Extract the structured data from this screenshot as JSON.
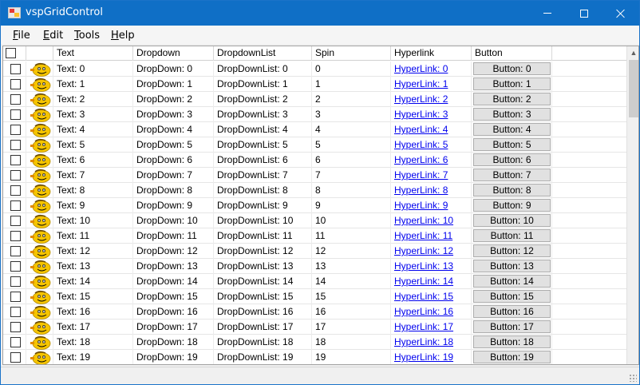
{
  "window": {
    "title": "vspGridControl"
  },
  "menu": [
    {
      "label": "File",
      "mnemonic": "F",
      "rest": "ile"
    },
    {
      "label": "Edit",
      "mnemonic": "E",
      "rest": "dit"
    },
    {
      "label": "Tools",
      "mnemonic": "T",
      "rest": "ools"
    },
    {
      "label": "Help",
      "mnemonic": "H",
      "rest": "elp"
    }
  ],
  "grid": {
    "columns": [
      "Text",
      "Dropdown",
      "DropdownList",
      "Spin",
      "Hyperlink",
      "Button"
    ],
    "row_icon": "smiley-face-icon",
    "rows": [
      {
        "checked": false,
        "text": "Text: 0",
        "dropdown": "DropDown: 0",
        "dropdownlist": "DropDownList: 0",
        "spin": "0",
        "hyperlink": "HyperLink: 0",
        "button": "Button: 0"
      },
      {
        "checked": false,
        "text": "Text: 1",
        "dropdown": "DropDown: 1",
        "dropdownlist": "DropDownList: 1",
        "spin": "1",
        "hyperlink": "HyperLink: 1",
        "button": "Button: 1"
      },
      {
        "checked": false,
        "text": "Text: 2",
        "dropdown": "DropDown: 2",
        "dropdownlist": "DropDownList: 2",
        "spin": "2",
        "hyperlink": "HyperLink: 2",
        "button": "Button: 2"
      },
      {
        "checked": false,
        "text": "Text: 3",
        "dropdown": "DropDown: 3",
        "dropdownlist": "DropDownList: 3",
        "spin": "3",
        "hyperlink": "HyperLink: 3",
        "button": "Button: 3"
      },
      {
        "checked": false,
        "text": "Text: 4",
        "dropdown": "DropDown: 4",
        "dropdownlist": "DropDownList: 4",
        "spin": "4",
        "hyperlink": "HyperLink: 4",
        "button": "Button: 4"
      },
      {
        "checked": false,
        "text": "Text: 5",
        "dropdown": "DropDown: 5",
        "dropdownlist": "DropDownList: 5",
        "spin": "5",
        "hyperlink": "HyperLink: 5",
        "button": "Button: 5"
      },
      {
        "checked": false,
        "text": "Text: 6",
        "dropdown": "DropDown: 6",
        "dropdownlist": "DropDownList: 6",
        "spin": "6",
        "hyperlink": "HyperLink: 6",
        "button": "Button: 6"
      },
      {
        "checked": false,
        "text": "Text: 7",
        "dropdown": "DropDown: 7",
        "dropdownlist": "DropDownList: 7",
        "spin": "7",
        "hyperlink": "HyperLink: 7",
        "button": "Button: 7"
      },
      {
        "checked": false,
        "text": "Text: 8",
        "dropdown": "DropDown: 8",
        "dropdownlist": "DropDownList: 8",
        "spin": "8",
        "hyperlink": "HyperLink: 8",
        "button": "Button: 8"
      },
      {
        "checked": false,
        "text": "Text: 9",
        "dropdown": "DropDown: 9",
        "dropdownlist": "DropDownList: 9",
        "spin": "9",
        "hyperlink": "HyperLink: 9",
        "button": "Button: 9"
      },
      {
        "checked": false,
        "text": "Text: 10",
        "dropdown": "DropDown: 10",
        "dropdownlist": "DropDownList: 10",
        "spin": "10",
        "hyperlink": "HyperLink: 10",
        "button": "Button: 10"
      },
      {
        "checked": false,
        "text": "Text: 11",
        "dropdown": "DropDown: 11",
        "dropdownlist": "DropDownList: 11",
        "spin": "11",
        "hyperlink": "HyperLink: 11",
        "button": "Button: 11"
      },
      {
        "checked": false,
        "text": "Text: 12",
        "dropdown": "DropDown: 12",
        "dropdownlist": "DropDownList: 12",
        "spin": "12",
        "hyperlink": "HyperLink: 12",
        "button": "Button: 12"
      },
      {
        "checked": false,
        "text": "Text: 13",
        "dropdown": "DropDown: 13",
        "dropdownlist": "DropDownList: 13",
        "spin": "13",
        "hyperlink": "HyperLink: 13",
        "button": "Button: 13"
      },
      {
        "checked": false,
        "text": "Text: 14",
        "dropdown": "DropDown: 14",
        "dropdownlist": "DropDownList: 14",
        "spin": "14",
        "hyperlink": "HyperLink: 14",
        "button": "Button: 14"
      },
      {
        "checked": false,
        "text": "Text: 15",
        "dropdown": "DropDown: 15",
        "dropdownlist": "DropDownList: 15",
        "spin": "15",
        "hyperlink": "HyperLink: 15",
        "button": "Button: 15"
      },
      {
        "checked": false,
        "text": "Text: 16",
        "dropdown": "DropDown: 16",
        "dropdownlist": "DropDownList: 16",
        "spin": "16",
        "hyperlink": "HyperLink: 16",
        "button": "Button: 16"
      },
      {
        "checked": false,
        "text": "Text: 17",
        "dropdown": "DropDown: 17",
        "dropdownlist": "DropDownList: 17",
        "spin": "17",
        "hyperlink": "HyperLink: 17",
        "button": "Button: 17"
      },
      {
        "checked": false,
        "text": "Text: 18",
        "dropdown": "DropDown: 18",
        "dropdownlist": "DropDownList: 18",
        "spin": "18",
        "hyperlink": "HyperLink: 18",
        "button": "Button: 18"
      },
      {
        "checked": false,
        "text": "Text: 19",
        "dropdown": "DropDown: 19",
        "dropdownlist": "DropDownList: 19",
        "spin": "19",
        "hyperlink": "HyperLink: 19",
        "button": "Button: 19"
      }
    ]
  },
  "colors": {
    "titlebar": "#0f6fc6",
    "link": "#0000ee",
    "face_yellow": "#f5c400"
  }
}
